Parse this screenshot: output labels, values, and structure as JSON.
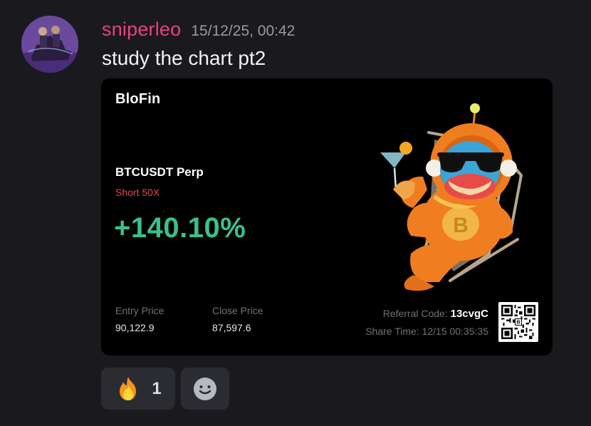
{
  "message": {
    "username": "sniperleo",
    "timestamp": "15/12/25, 00:42",
    "text": "study the chart pt2"
  },
  "card": {
    "brand": "BloFin",
    "pair": "BTCUSDT Perp",
    "side": "Short 50X",
    "pnl": "+140.10%",
    "entry_label": "Entry Price",
    "entry_value": "90,122.9",
    "close_label": "Close Price",
    "close_value": "87,597.6",
    "referral_label": "Referral Code:",
    "referral_code": "13cvgC",
    "share_time": "Share Time: 12/15 00:35:35",
    "colors": {
      "pnl": "#3cc08a",
      "side": "#e5484d"
    }
  },
  "reactions": [
    {
      "emoji": "fire",
      "count": "1"
    },
    {
      "emoji": "add-reaction"
    }
  ]
}
